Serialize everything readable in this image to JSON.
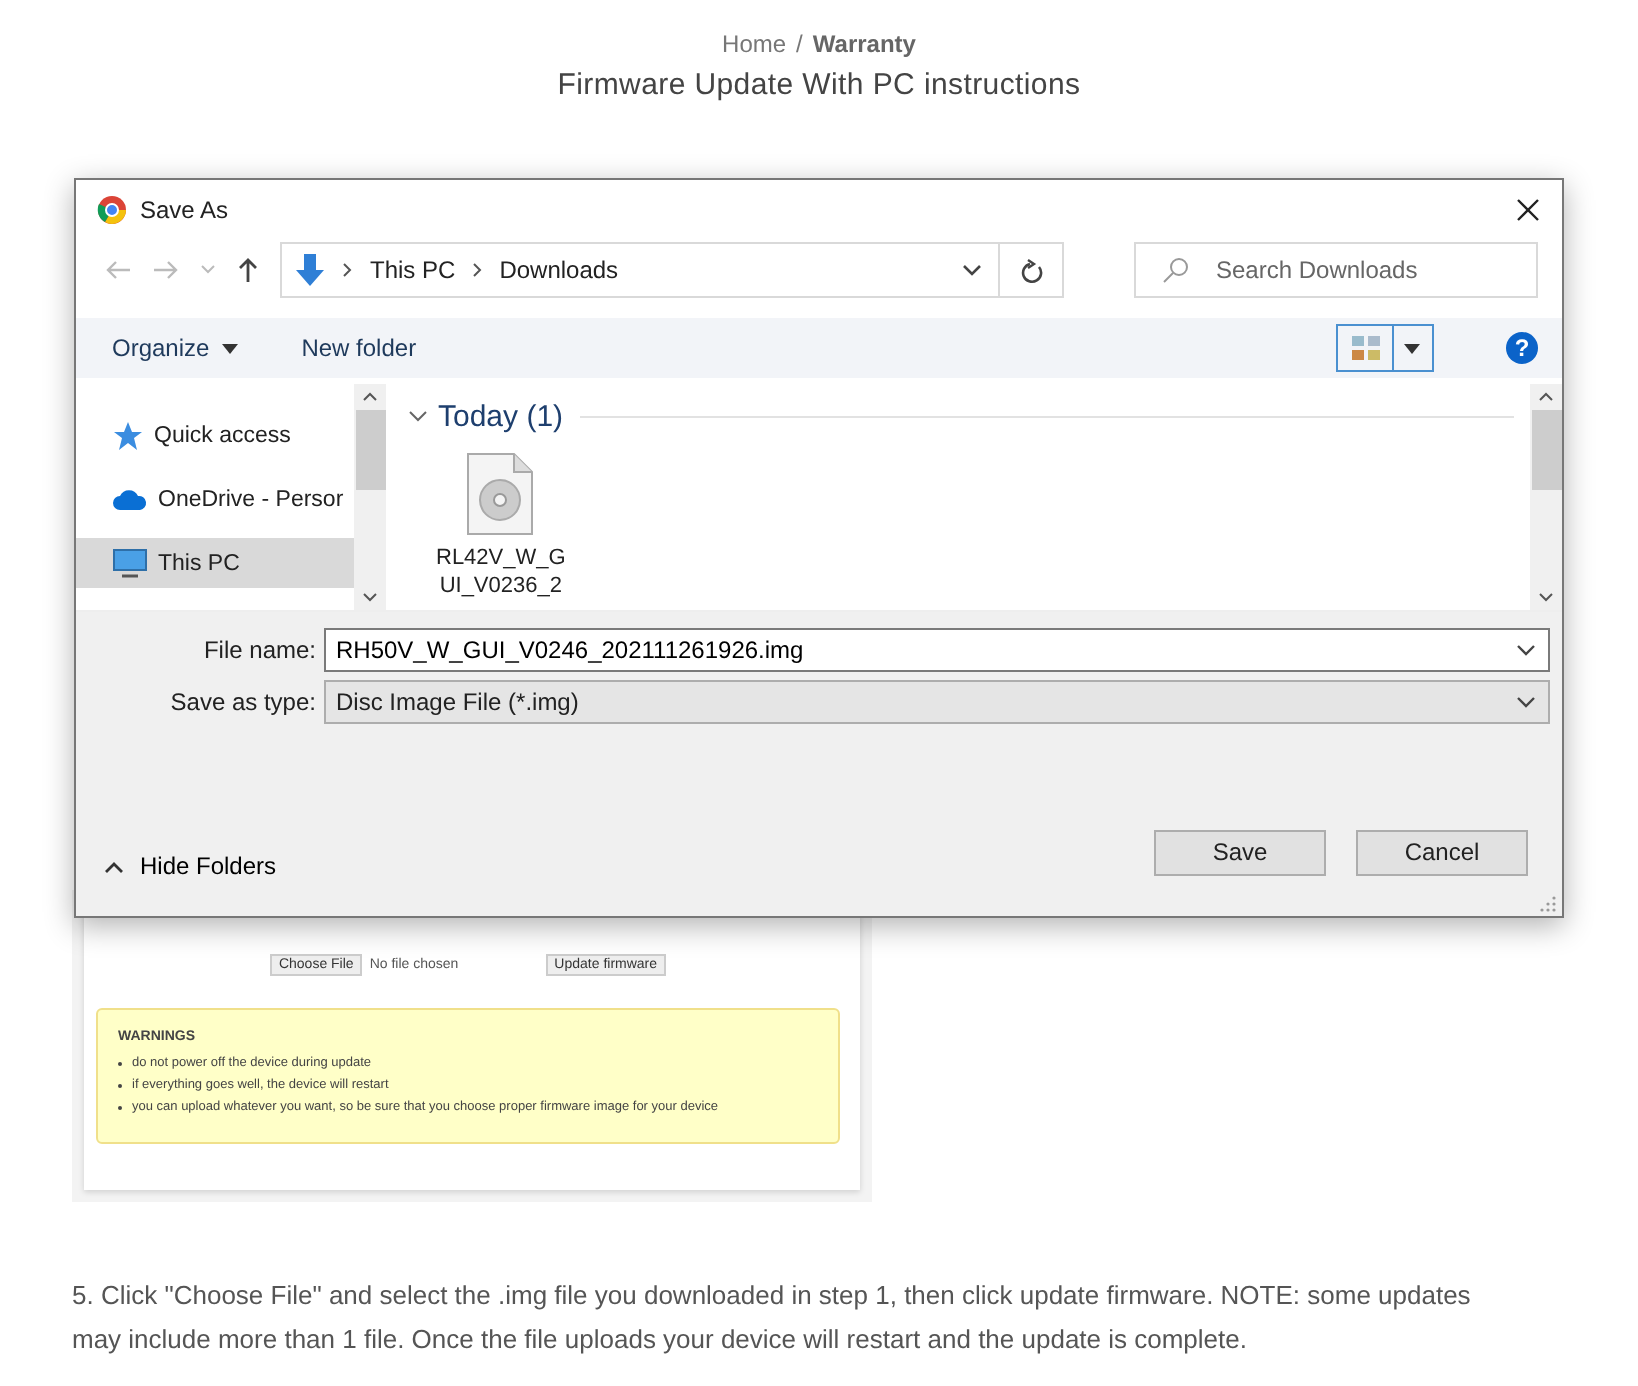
{
  "breadcrumb": {
    "items": [
      {
        "label": "Home",
        "selected": false
      },
      {
        "label": "Warranty",
        "selected": true
      }
    ],
    "separator": "/"
  },
  "heading": "Firmware Update With PC instructions",
  "dialog": {
    "title": "Save As",
    "address": {
      "segments": [
        "This PC",
        "Downloads"
      ]
    },
    "search": {
      "placeholder": "Search Downloads"
    },
    "toolbar": {
      "organize": "Organize",
      "new_folder": "New folder",
      "help": "?"
    },
    "nav_items": [
      {
        "label": "Quick access",
        "kind": "star",
        "selected": false
      },
      {
        "label": "OneDrive - Persor",
        "kind": "cloud",
        "selected": false
      },
      {
        "label": "This PC",
        "kind": "pc",
        "selected": true
      }
    ],
    "group": {
      "label": "Today (1)",
      "expanded": true
    },
    "files": [
      {
        "label_lines": [
          "RL42V_W_G",
          "UI_V0236_2"
        ]
      }
    ],
    "file_name": {
      "label": "File name:",
      "value": "RH50V_W_GUI_V0246_202111261926.img"
    },
    "save_type": {
      "label": "Save as type:",
      "value": "Disc Image File (*.img)"
    },
    "hide_folders": "Hide Folders",
    "buttons": [
      "Save",
      "Cancel"
    ]
  },
  "embedded": {
    "choose_file": "Choose File",
    "no_file": "No file chosen",
    "update": "Update firmware",
    "warnings": {
      "title": "WARNINGS",
      "items": [
        "do not power off the device during update",
        "if everything goes well, the device will restart",
        "you can upload whatever you want, so be sure that you choose proper firmware image for your device"
      ]
    }
  },
  "paragraph": "5. Click \"Choose File\" and select the .img file you downloaded in step 1, then click update firmware. NOTE: some updates may include more than 1 file. Once the file uploads your device will restart and the update is complete."
}
